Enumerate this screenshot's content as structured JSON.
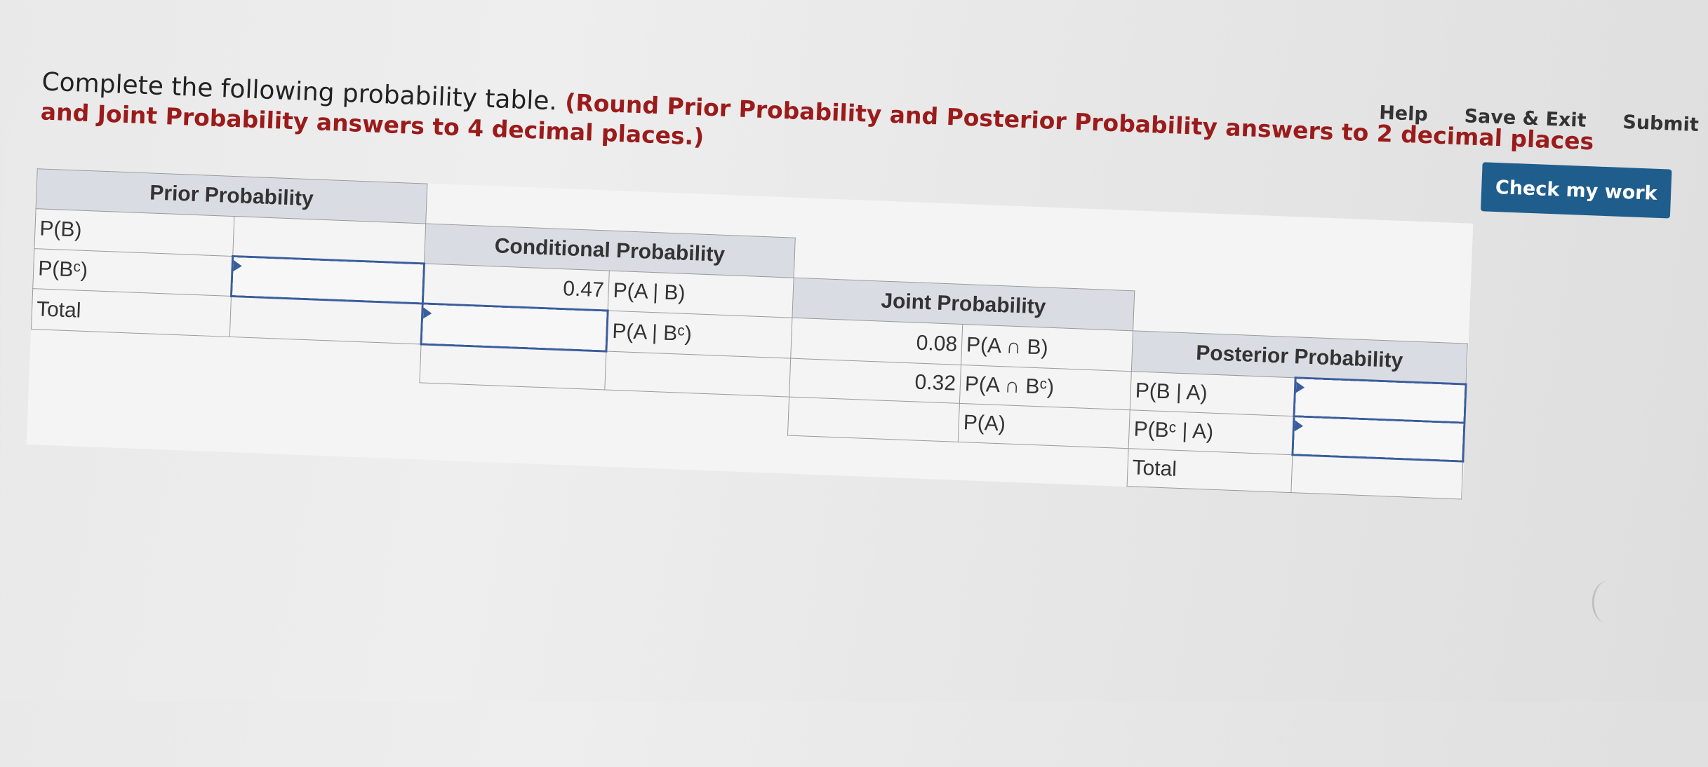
{
  "nav": {
    "help": "Help",
    "save_exit": "Save & Exit",
    "submit": "Submit",
    "check_my_work": "Check my work"
  },
  "instructions": {
    "main": "Complete the following probability table. ",
    "emphasis": "(Round Prior Probability and Posterior Probability answers to 2 decimal places and Joint Probability answers to 4 decimal places.)"
  },
  "table": {
    "headers": {
      "prior": "Prior Probability",
      "conditional": "Conditional Probability",
      "joint": "Joint Probability",
      "posterior": "Posterior Probability"
    },
    "prior_rows": [
      "P(B)",
      "P(Bᶜ)",
      "Total"
    ],
    "conditional": {
      "row1_value": "0.47",
      "row1_label": "P(A | B)",
      "row2_label": "P(A | Bᶜ)"
    },
    "joint": {
      "row1_value": "0.08",
      "row1_label": "P(A ∩ B)",
      "row2_value": "0.32",
      "row2_label": "P(A ∩ Bᶜ)",
      "row3_label": "P(A)"
    },
    "posterior_rows": [
      "P(B | A)",
      "P(Bᶜ | A)",
      "Total"
    ]
  }
}
